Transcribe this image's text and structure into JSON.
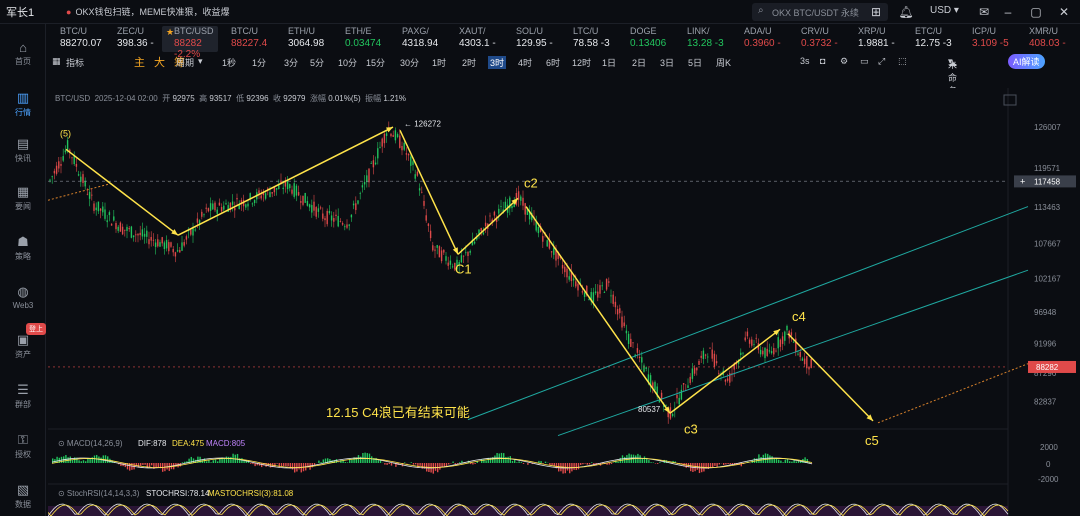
{
  "app": {
    "brand": "军长1",
    "news": "OKX钱包扫链，MEME快准狠，收益爆",
    "search_placeholder": "OKX BTC/USDT 永续",
    "currency": "USD"
  },
  "sidebar": [
    {
      "id": "home",
      "label": "首页",
      "icon": "home-icon"
    },
    {
      "id": "market",
      "label": "行情",
      "icon": "chart-icon",
      "active": true
    },
    {
      "id": "flash",
      "label": "快讯",
      "icon": "flash-icon"
    },
    {
      "id": "news",
      "label": "要闻",
      "icon": "news-icon"
    },
    {
      "id": "strategy",
      "label": "策略",
      "icon": "robot-icon"
    },
    {
      "id": "web3",
      "label": "Web3",
      "icon": "globe-icon"
    },
    {
      "id": "assets",
      "label": "资产",
      "icon": "wallet-icon",
      "badge": "登上"
    },
    {
      "id": "community",
      "label": "群部",
      "icon": "group-icon"
    },
    {
      "id": "license",
      "label": "授权",
      "icon": "key-icon"
    },
    {
      "id": "data",
      "label": "数据",
      "icon": "data-icon"
    }
  ],
  "tickers": [
    {
      "sym": "BTC/U",
      "price": "88270.07",
      "color": "#e6e8ec"
    },
    {
      "sym": "ZEC/U",
      "price": "398.36 -",
      "color": "#e6e8ec"
    },
    {
      "sym": "BTC/USD",
      "price": "88282 -2.2%",
      "color": "#e04a4a",
      "active": true
    },
    {
      "sym": "BTC/U",
      "price": "88227.4",
      "color": "#e04a4a"
    },
    {
      "sym": "ETH/U",
      "price": "3064.98",
      "color": "#e6e8ec"
    },
    {
      "sym": "ETH/E",
      "price": "0.03474",
      "color": "#22c55e"
    },
    {
      "sym": "PAXG/",
      "price": "4318.94",
      "color": "#e6e8ec"
    },
    {
      "sym": "XAUT/",
      "price": "4303.1 -",
      "color": "#e6e8ec"
    },
    {
      "sym": "SOL/U",
      "price": "129.95 -",
      "color": "#e6e8ec"
    },
    {
      "sym": "LTC/U",
      "price": "78.58 -3",
      "color": "#e6e8ec"
    },
    {
      "sym": "DOGE",
      "price": "0.13406",
      "color": "#22c55e"
    },
    {
      "sym": "LINK/",
      "price": "13.28 -3",
      "color": "#22c55e"
    },
    {
      "sym": "ADA/U",
      "price": "0.3960 -",
      "color": "#e04a4a"
    },
    {
      "sym": "CRV/U",
      "price": "0.3732 -",
      "color": "#e04a4a"
    },
    {
      "sym": "XRP/U",
      "price": "1.9881 -",
      "color": "#e6e8ec"
    },
    {
      "sym": "ETC/U",
      "price": "12.75 -3",
      "color": "#e6e8ec"
    },
    {
      "sym": "ICP/U",
      "price": "3.109 -5",
      "color": "#e04a4a"
    },
    {
      "sym": "XMR/U",
      "price": "408.03 -",
      "color": "#e04a4a"
    }
  ],
  "toolbar": {
    "indicator": "指标",
    "marks": [
      "主",
      "大",
      "筹"
    ],
    "period": "周期",
    "intervals": [
      "1秒",
      "1分",
      "3分",
      "5分",
      "10分",
      "15分",
      "30分",
      "1时",
      "2时",
      "3时",
      "4时",
      "6时",
      "12时",
      "1日",
      "2日",
      "3日",
      "5日",
      "周K"
    ],
    "active_interval": "3时",
    "refresh": "3s",
    "unnamed": "未命名",
    "ai": "AI解读"
  },
  "info": {
    "symbol": "BTC/USD",
    "time": "2025-12-04 02:00",
    "open_label": "开",
    "open": "92975",
    "high_label": "高",
    "high": "93517",
    "low_label": "低",
    "low": "92396",
    "close_label": "收",
    "close": "92979",
    "change_label": "涨幅",
    "change": "0.01%(5)",
    "amp_label": "振幅",
    "amp": "1.21%"
  },
  "price_axis": [
    "126007",
    "119571",
    "113463",
    "107667",
    "102167",
    "96948",
    "91996",
    "87296",
    "82837"
  ],
  "price_tags": {
    "current": "88282",
    "crosshair": "117458",
    "peak": "126272",
    "low": "80537"
  },
  "wave_labels": {
    "w5": "(5)",
    "c1": "C1",
    "c2": "c2",
    "c3": "c3",
    "c4": "c4",
    "c5": "c5"
  },
  "note": "12.15 C4浪已有结束可能",
  "macd": {
    "name": "MACD(14,26,9)",
    "dif_label": "DIF",
    "dif": "878",
    "dea_label": "DEA",
    "dea": "475",
    "macd_label": "MACD",
    "macd": "805",
    "axis": [
      "2000",
      "0",
      "-2000"
    ]
  },
  "stochrsi": {
    "name": "StochRSI(14,14,3,3)",
    "k_label": "STOCHRSI",
    "k": "78.14",
    "d_label": "MASTOCHRSI(3)",
    "d": "81.08"
  },
  "colors": {
    "up": "#22c55e",
    "down": "#e04a4a",
    "annotation": "#ffe34a",
    "channel": "#1fa8a0",
    "accent": "#4da3ff"
  }
}
